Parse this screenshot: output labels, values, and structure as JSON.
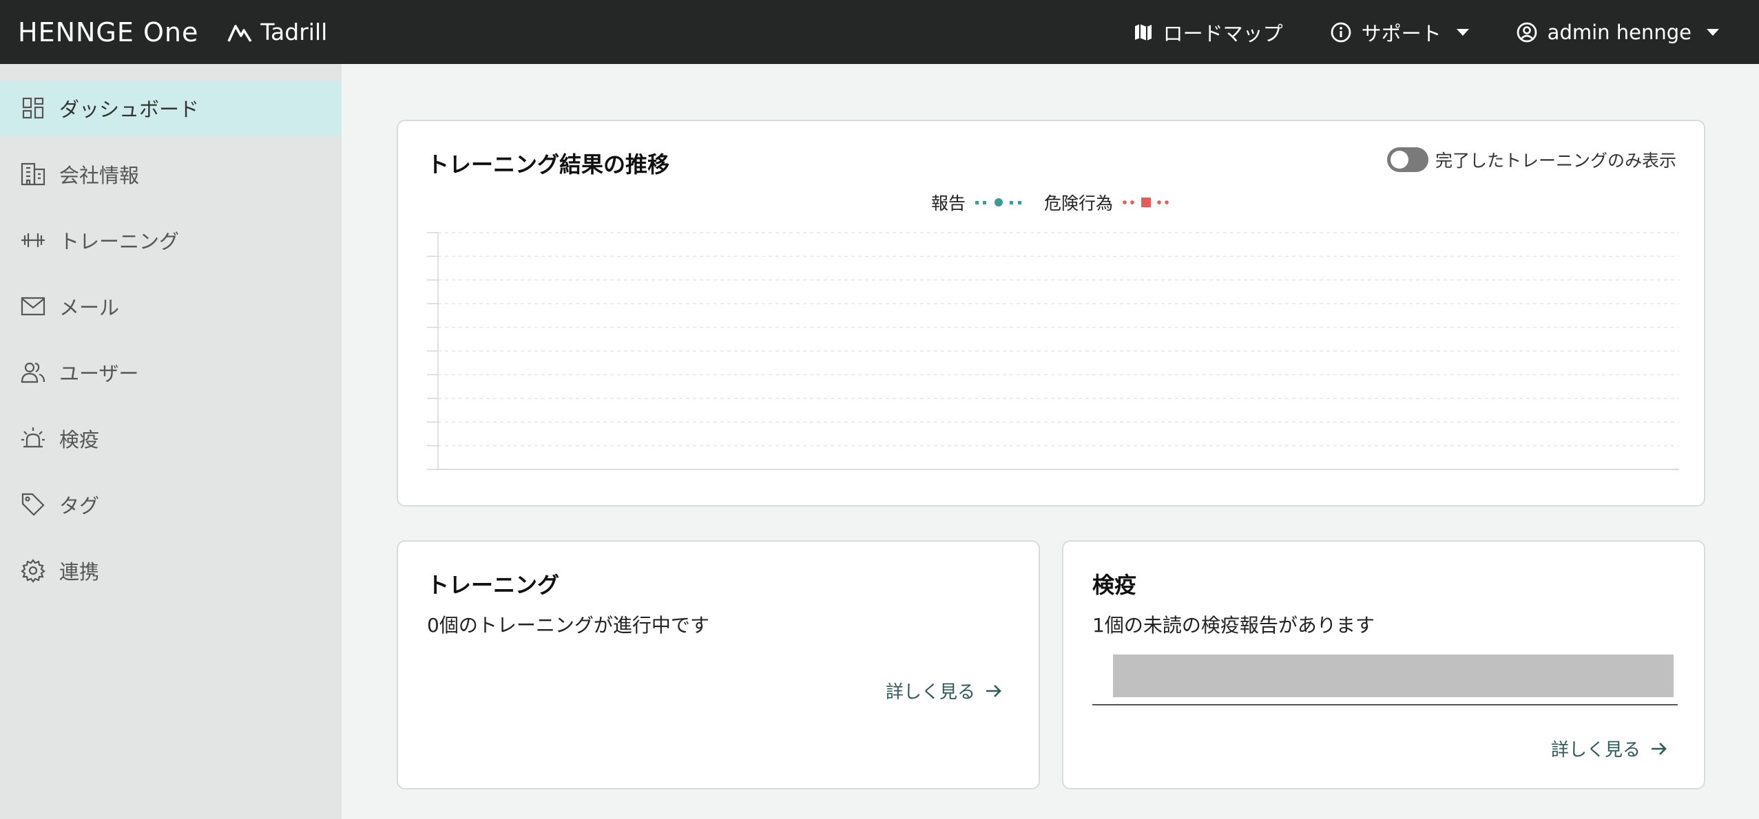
{
  "header": {
    "brand": "HENNGE One",
    "product": "Tadrill",
    "nav": [
      {
        "label": "ロードマップ",
        "icon": "map-icon"
      },
      {
        "label": "サポート",
        "icon": "info-icon"
      },
      {
        "label": "admin hennge",
        "icon": "user-circle-icon"
      }
    ]
  },
  "sidebar": {
    "items": [
      {
        "label": "ダッシュボード",
        "icon": "dashboard-icon",
        "active": true
      },
      {
        "label": "会社情報",
        "icon": "building-icon"
      },
      {
        "label": "トレーニング",
        "icon": "dumbbell-icon"
      },
      {
        "label": "メール",
        "icon": "mail-icon"
      },
      {
        "label": "ユーザー",
        "icon": "users-icon"
      },
      {
        "label": "検疫",
        "icon": "alarm-light-icon"
      },
      {
        "label": "タグ",
        "icon": "tag-icon"
      },
      {
        "label": "連携",
        "icon": "gear-icon"
      }
    ]
  },
  "trend_card": {
    "title": "トレーニング結果の推移",
    "toggle_label": "完了したトレーニングのみ表示",
    "toggle_on": false
  },
  "chart_data": {
    "type": "line",
    "title": "トレーニング結果の推移",
    "series": [
      {
        "name": "報告",
        "color": "#3d9a97",
        "values": []
      },
      {
        "name": "危険行為",
        "color": "#e85a55",
        "values": []
      }
    ],
    "categories": [],
    "grid": true,
    "legend": "top-center"
  },
  "training_card": {
    "title": "トレーニング",
    "text": "0個のトレーニングが進行中です",
    "link": "詳しく見る"
  },
  "quarantine_card": {
    "title": "検疫",
    "text": "1個の未読の検疫報告があります",
    "link": "詳しく見る"
  }
}
